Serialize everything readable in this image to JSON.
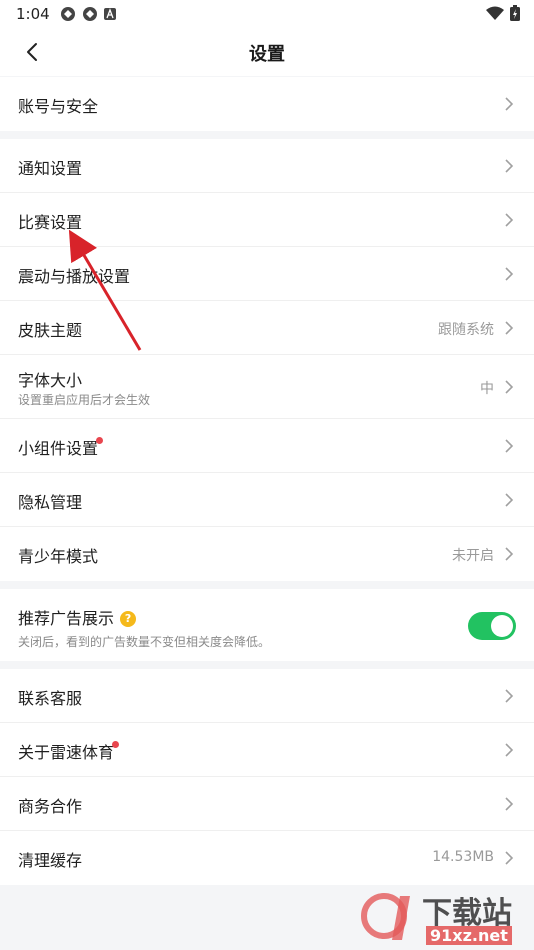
{
  "status": {
    "time": "1:04"
  },
  "header": {
    "title": "设置"
  },
  "groups": [
    {
      "items": [
        {
          "label": "账号与安全"
        }
      ]
    },
    {
      "items": [
        {
          "label": "通知设置"
        },
        {
          "label": "比赛设置"
        },
        {
          "label": "震动与播放设置"
        },
        {
          "label": "皮肤主题",
          "value": "跟随系统"
        },
        {
          "label": "字体大小",
          "sub": "设置重启应用后才会生效",
          "value": "中"
        },
        {
          "label": "小组件设置"
        },
        {
          "label": "隐私管理"
        },
        {
          "label": "青少年模式",
          "value": "未开启"
        }
      ]
    },
    {
      "items": [
        {
          "label": "推荐广告展示",
          "sub": "关闭后，看到的广告数量不变但相关度会降低。",
          "toggle_on": true
        }
      ]
    },
    {
      "items": [
        {
          "label": "联系客服"
        },
        {
          "label": "关于雷速体育"
        },
        {
          "label": "商务合作"
        },
        {
          "label": "清理缓存",
          "value": "14.53MB"
        }
      ]
    }
  ],
  "watermark": {
    "text": "下载站",
    "url": "91xz.net"
  },
  "colors": {
    "toggle": "#22c261",
    "badge": "#e8464e",
    "help": "#f5b91b",
    "arrow": "#d8232a"
  }
}
